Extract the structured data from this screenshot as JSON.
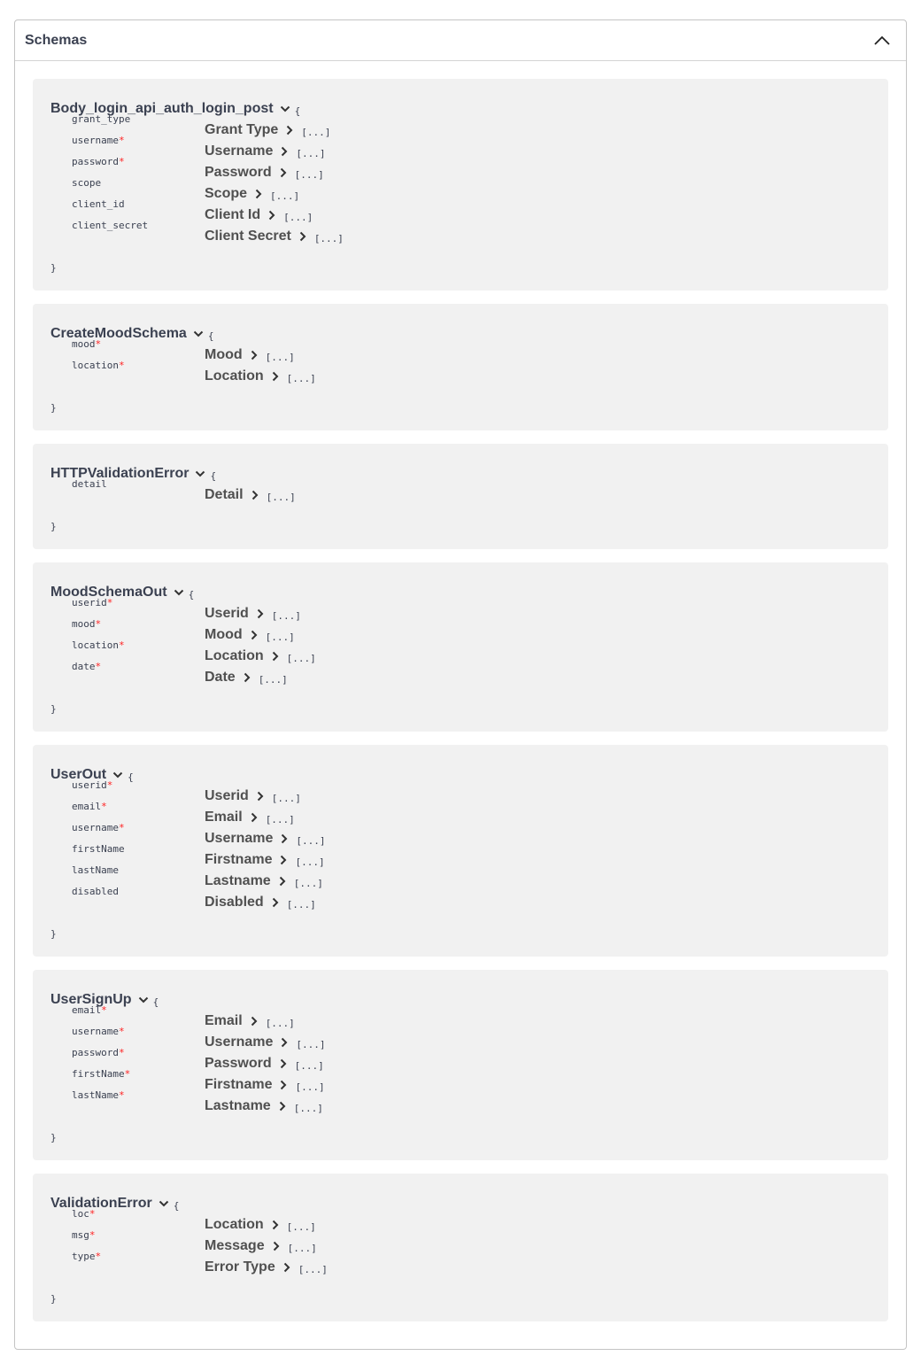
{
  "section": {
    "title": "Schemas"
  },
  "models": [
    {
      "name": "Body_login_api_auth_login_post",
      "open_brace": "{",
      "close_brace": "}",
      "props": [
        {
          "key": "grant_type",
          "required": false,
          "title": "Grant Type",
          "more": "[...]"
        },
        {
          "key": "username",
          "required": true,
          "title": "Username",
          "more": "[...]"
        },
        {
          "key": "password",
          "required": true,
          "title": "Password",
          "more": "[...]"
        },
        {
          "key": "scope",
          "required": false,
          "title": "Scope",
          "more": "[...]"
        },
        {
          "key": "client_id",
          "required": false,
          "title": "Client Id",
          "more": "[...]"
        },
        {
          "key": "client_secret",
          "required": false,
          "title": "Client Secret",
          "more": "[...]"
        }
      ]
    },
    {
      "name": "CreateMoodSchema",
      "open_brace": "{",
      "close_brace": "}",
      "props": [
        {
          "key": "mood",
          "required": true,
          "title": "Mood",
          "more": "[...]"
        },
        {
          "key": "location",
          "required": true,
          "title": "Location",
          "more": "[...]"
        }
      ]
    },
    {
      "name": "HTTPValidationError",
      "open_brace": "{",
      "close_brace": "}",
      "props": [
        {
          "key": "detail",
          "required": false,
          "title": "Detail",
          "more": "[...]"
        }
      ]
    },
    {
      "name": "MoodSchemaOut",
      "open_brace": "{",
      "close_brace": "}",
      "props": [
        {
          "key": "userid",
          "required": true,
          "title": "Userid",
          "more": "[...]"
        },
        {
          "key": "mood",
          "required": true,
          "title": "Mood",
          "more": "[...]"
        },
        {
          "key": "location",
          "required": true,
          "title": "Location",
          "more": "[...]"
        },
        {
          "key": "date",
          "required": true,
          "title": "Date",
          "more": "[...]"
        }
      ]
    },
    {
      "name": "UserOut",
      "open_brace": "{",
      "close_brace": "}",
      "props": [
        {
          "key": "userid",
          "required": true,
          "title": "Userid",
          "more": "[...]"
        },
        {
          "key": "email",
          "required": true,
          "title": "Email",
          "more": "[...]"
        },
        {
          "key": "username",
          "required": true,
          "title": "Username",
          "more": "[...]"
        },
        {
          "key": "firstName",
          "required": false,
          "title": "Firstname",
          "more": "[...]"
        },
        {
          "key": "lastName",
          "required": false,
          "title": "Lastname",
          "more": "[...]"
        },
        {
          "key": "disabled",
          "required": false,
          "title": "Disabled",
          "more": "[...]"
        }
      ]
    },
    {
      "name": "UserSignUp",
      "open_brace": "{",
      "close_brace": "}",
      "props": [
        {
          "key": "email",
          "required": true,
          "title": "Email",
          "more": "[...]"
        },
        {
          "key": "username",
          "required": true,
          "title": "Username",
          "more": "[...]"
        },
        {
          "key": "password",
          "required": true,
          "title": "Password",
          "more": "[...]"
        },
        {
          "key": "firstName",
          "required": true,
          "title": "Firstname",
          "more": "[...]"
        },
        {
          "key": "lastName",
          "required": true,
          "title": "Lastname",
          "more": "[...]"
        }
      ]
    },
    {
      "name": "ValidationError",
      "open_brace": "{",
      "close_brace": "}",
      "props": [
        {
          "key": "loc",
          "required": true,
          "title": "Location",
          "more": "[...]"
        },
        {
          "key": "msg",
          "required": true,
          "title": "Message",
          "more": "[...]"
        },
        {
          "key": "type",
          "required": true,
          "title": "Error Type",
          "more": "[...]"
        }
      ]
    }
  ],
  "required_marker": "*",
  "icons": {
    "collapse": "chevron-up-icon",
    "model_toggle": "chevron-down-icon",
    "prop_expand": "chevron-right-icon"
  },
  "colors": {
    "required": "#ff2323",
    "text": "#3b4151",
    "panel": "#f1f1f1"
  }
}
